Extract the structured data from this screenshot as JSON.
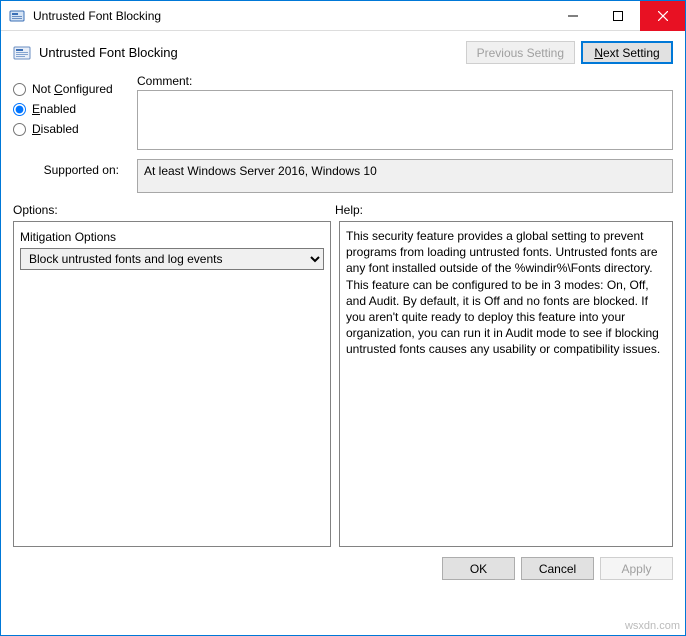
{
  "window": {
    "title": "Untrusted Font Blocking"
  },
  "header": {
    "title": "Untrusted Font Blocking",
    "prev_label": "Previous Setting",
    "next_label_prefix": "N",
    "next_label_rest": "ext Setting"
  },
  "radios": {
    "not_configured": "Not Configured",
    "enabled": "Enabled",
    "disabled": "Disabled",
    "selected": "enabled"
  },
  "comment": {
    "label": "Comment:",
    "value": ""
  },
  "supported": {
    "label": "Supported on:",
    "value": "At least Windows Server 2016, Windows 10"
  },
  "sections": {
    "options": "Options:",
    "help": "Help:"
  },
  "mitigation": {
    "label": "Mitigation Options",
    "selected": "Block untrusted fonts and log events"
  },
  "help_text": "This security feature provides a global setting to prevent programs from loading untrusted fonts. Untrusted fonts are any font installed outside of the %windir%\\Fonts directory. This feature can be configured to be in 3 modes: On, Off, and Audit. By default, it is Off and no fonts are blocked. If you aren't quite ready to deploy this feature into your organization, you can run it in Audit mode to see if blocking untrusted fonts causes any usability or compatibility issues.",
  "footer": {
    "ok": "OK",
    "cancel": "Cancel",
    "apply": "Apply"
  },
  "watermark": "wsxdn.com"
}
